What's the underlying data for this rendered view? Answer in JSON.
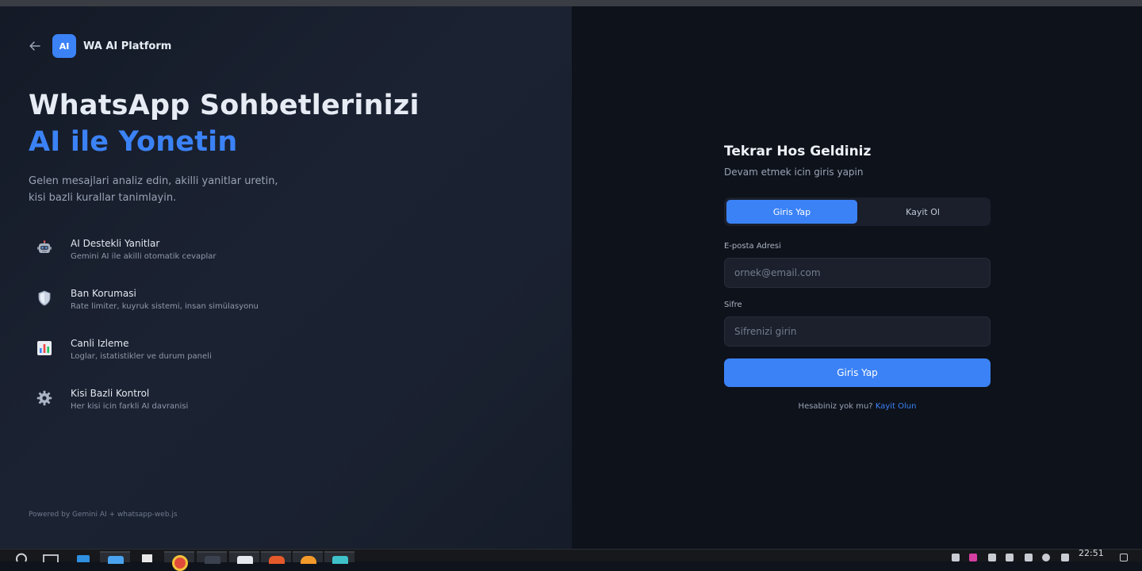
{
  "brand": {
    "back_icon": "arrow-left-icon",
    "logo_text": "AI",
    "name": "WA AI Platform"
  },
  "hero": {
    "title_line1": "WhatsApp Sohbetlerinizi",
    "title_line2": "AI ile Yonetin",
    "description": "Gelen mesajlari analiz edin, akilli yanitlar uretin, kisi bazli kurallar tanimlayin."
  },
  "features": [
    {
      "icon": "robot-icon",
      "title": "AI Destekli Yanitlar",
      "subtitle": "Gemini AI ile akilli otomatik cevaplar"
    },
    {
      "icon": "shield-icon",
      "title": "Ban Korumasi",
      "subtitle": "Rate limiter, kuyruk sistemi, insan simülasyonu"
    },
    {
      "icon": "bar-chart-icon",
      "title": "Canli Izleme",
      "subtitle": "Loglar, istatistikler ve durum paneli"
    },
    {
      "icon": "gear-icon",
      "title": "Kisi Bazli Kontrol",
      "subtitle": "Her kisi icin farkli AI davranisi"
    }
  ],
  "footer": {
    "powered_by": "Powered by Gemini AI + whatsapp-web.js"
  },
  "login": {
    "title": "Tekrar Hos Geldiniz",
    "subtitle": "Devam etmek icin giris yapin",
    "tabs": [
      {
        "label": "Giris Yap",
        "active": true
      },
      {
        "label": "Kayit Ol",
        "active": false
      }
    ],
    "email_label": "E-posta Adresi",
    "email_placeholder": "ornek@email.com",
    "password_label": "Sifre",
    "password_placeholder": "Sifrenizi girin",
    "submit_label": "Giris Yap",
    "signup_prompt": "Hesabiniz yok mu?",
    "signup_link": "Kayit Olun"
  },
  "taskbar": {
    "clock": "22:51"
  },
  "colors": {
    "accent": "#3b82f6",
    "left_bg": "#1b2232",
    "right_bg": "#0e121b"
  }
}
